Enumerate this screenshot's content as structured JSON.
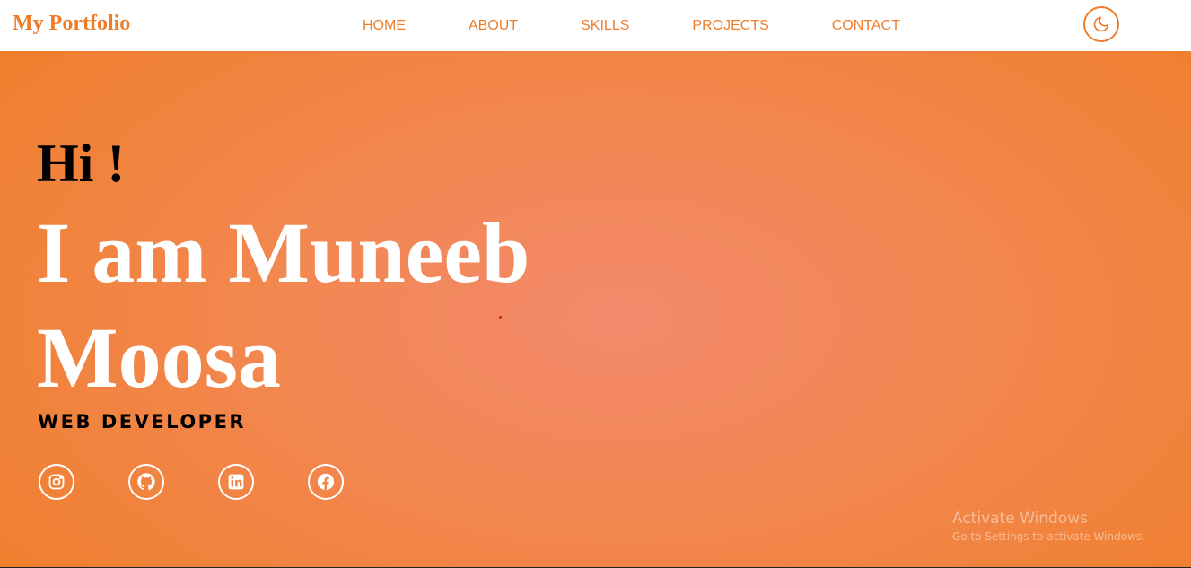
{
  "brand": {
    "title": "My Portfolio"
  },
  "nav": {
    "items": [
      {
        "label": "HOME"
      },
      {
        "label": "ABOUT"
      },
      {
        "label": "SKILLS"
      },
      {
        "label": "PROJECTS"
      },
      {
        "label": "CONTACT"
      }
    ],
    "theme_toggle_icon": "moon-icon"
  },
  "hero": {
    "greeting": "Hi !",
    "name_line1": "I am Muneeb",
    "name_line2": "Moosa",
    "role": "WEB DEVELOPER",
    "socials": [
      {
        "icon": "instagram-icon"
      },
      {
        "icon": "github-icon"
      },
      {
        "icon": "linkedin-icon"
      },
      {
        "icon": "facebook-icon"
      }
    ]
  },
  "colors": {
    "accent": "#ee7d2a",
    "hero_edge": "#ef7e29",
    "hero_center": "#f3896c",
    "text_dark": "#000000",
    "text_light": "#ffffff"
  },
  "watermark": {
    "title": "Activate Windows",
    "subtitle": "Go to Settings to activate Windows."
  }
}
